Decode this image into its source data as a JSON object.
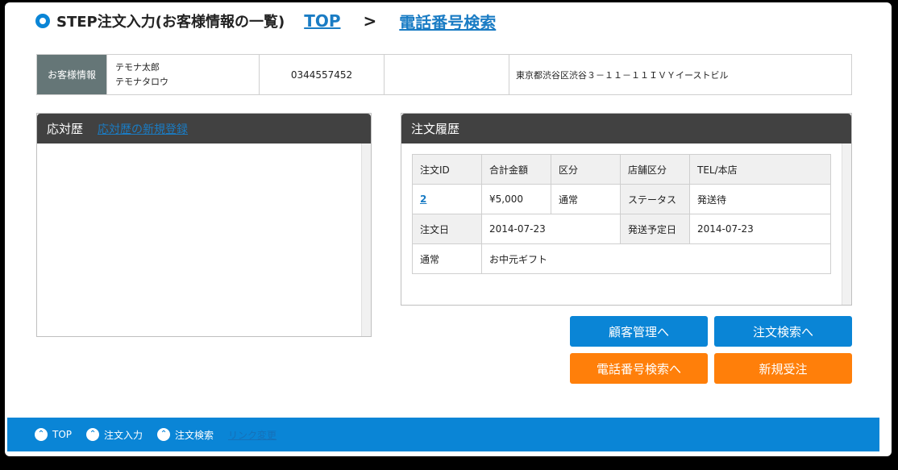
{
  "header": {
    "title": "STEP注文入力(お客様情報の一覧)",
    "breadcrumb_top": "TOP",
    "breadcrumb_sep": ">",
    "breadcrumb_current": "電話番号検索"
  },
  "customer": {
    "label": "お客様情報",
    "name": "テモナ太郎",
    "name_kana": "テモナタロウ",
    "phone": "0344557452",
    "empty": "",
    "address": "東京都渋谷区渋谷３－１１－１１ＩＶＹイーストビル"
  },
  "response_panel": {
    "title": "応対歴",
    "link": "応対歴の新規登録"
  },
  "order_panel": {
    "title": "注文履歴",
    "rows": [
      [
        "注文ID",
        "合計金額",
        "区分",
        "店舗区分",
        "TEL/本店"
      ],
      [
        "2",
        "¥5,000",
        "通常",
        "ステータス",
        "発送待"
      ],
      [
        "注文日",
        "2014-07-23",
        "",
        "発送予定日",
        "2014-07-23"
      ],
      [
        "通常",
        "お中元ギフト"
      ]
    ]
  },
  "buttons": {
    "customer_mgmt": "顧客管理へ",
    "order_search": "注文検索へ",
    "phone_search": "電話番号検索へ",
    "new_order": "新規受注"
  },
  "footer": {
    "items": [
      "TOP",
      "注文入力",
      "注文検索"
    ],
    "link": "リンク変更"
  },
  "colors": {
    "accent_blue": "#0a85d6",
    "accent_orange": "#ff7f0a",
    "panel_header": "#414141",
    "label_bg": "#657677"
  },
  "icons": {
    "header_icon": "ring-icon",
    "footer_icon": "chevron-up-icon"
  }
}
